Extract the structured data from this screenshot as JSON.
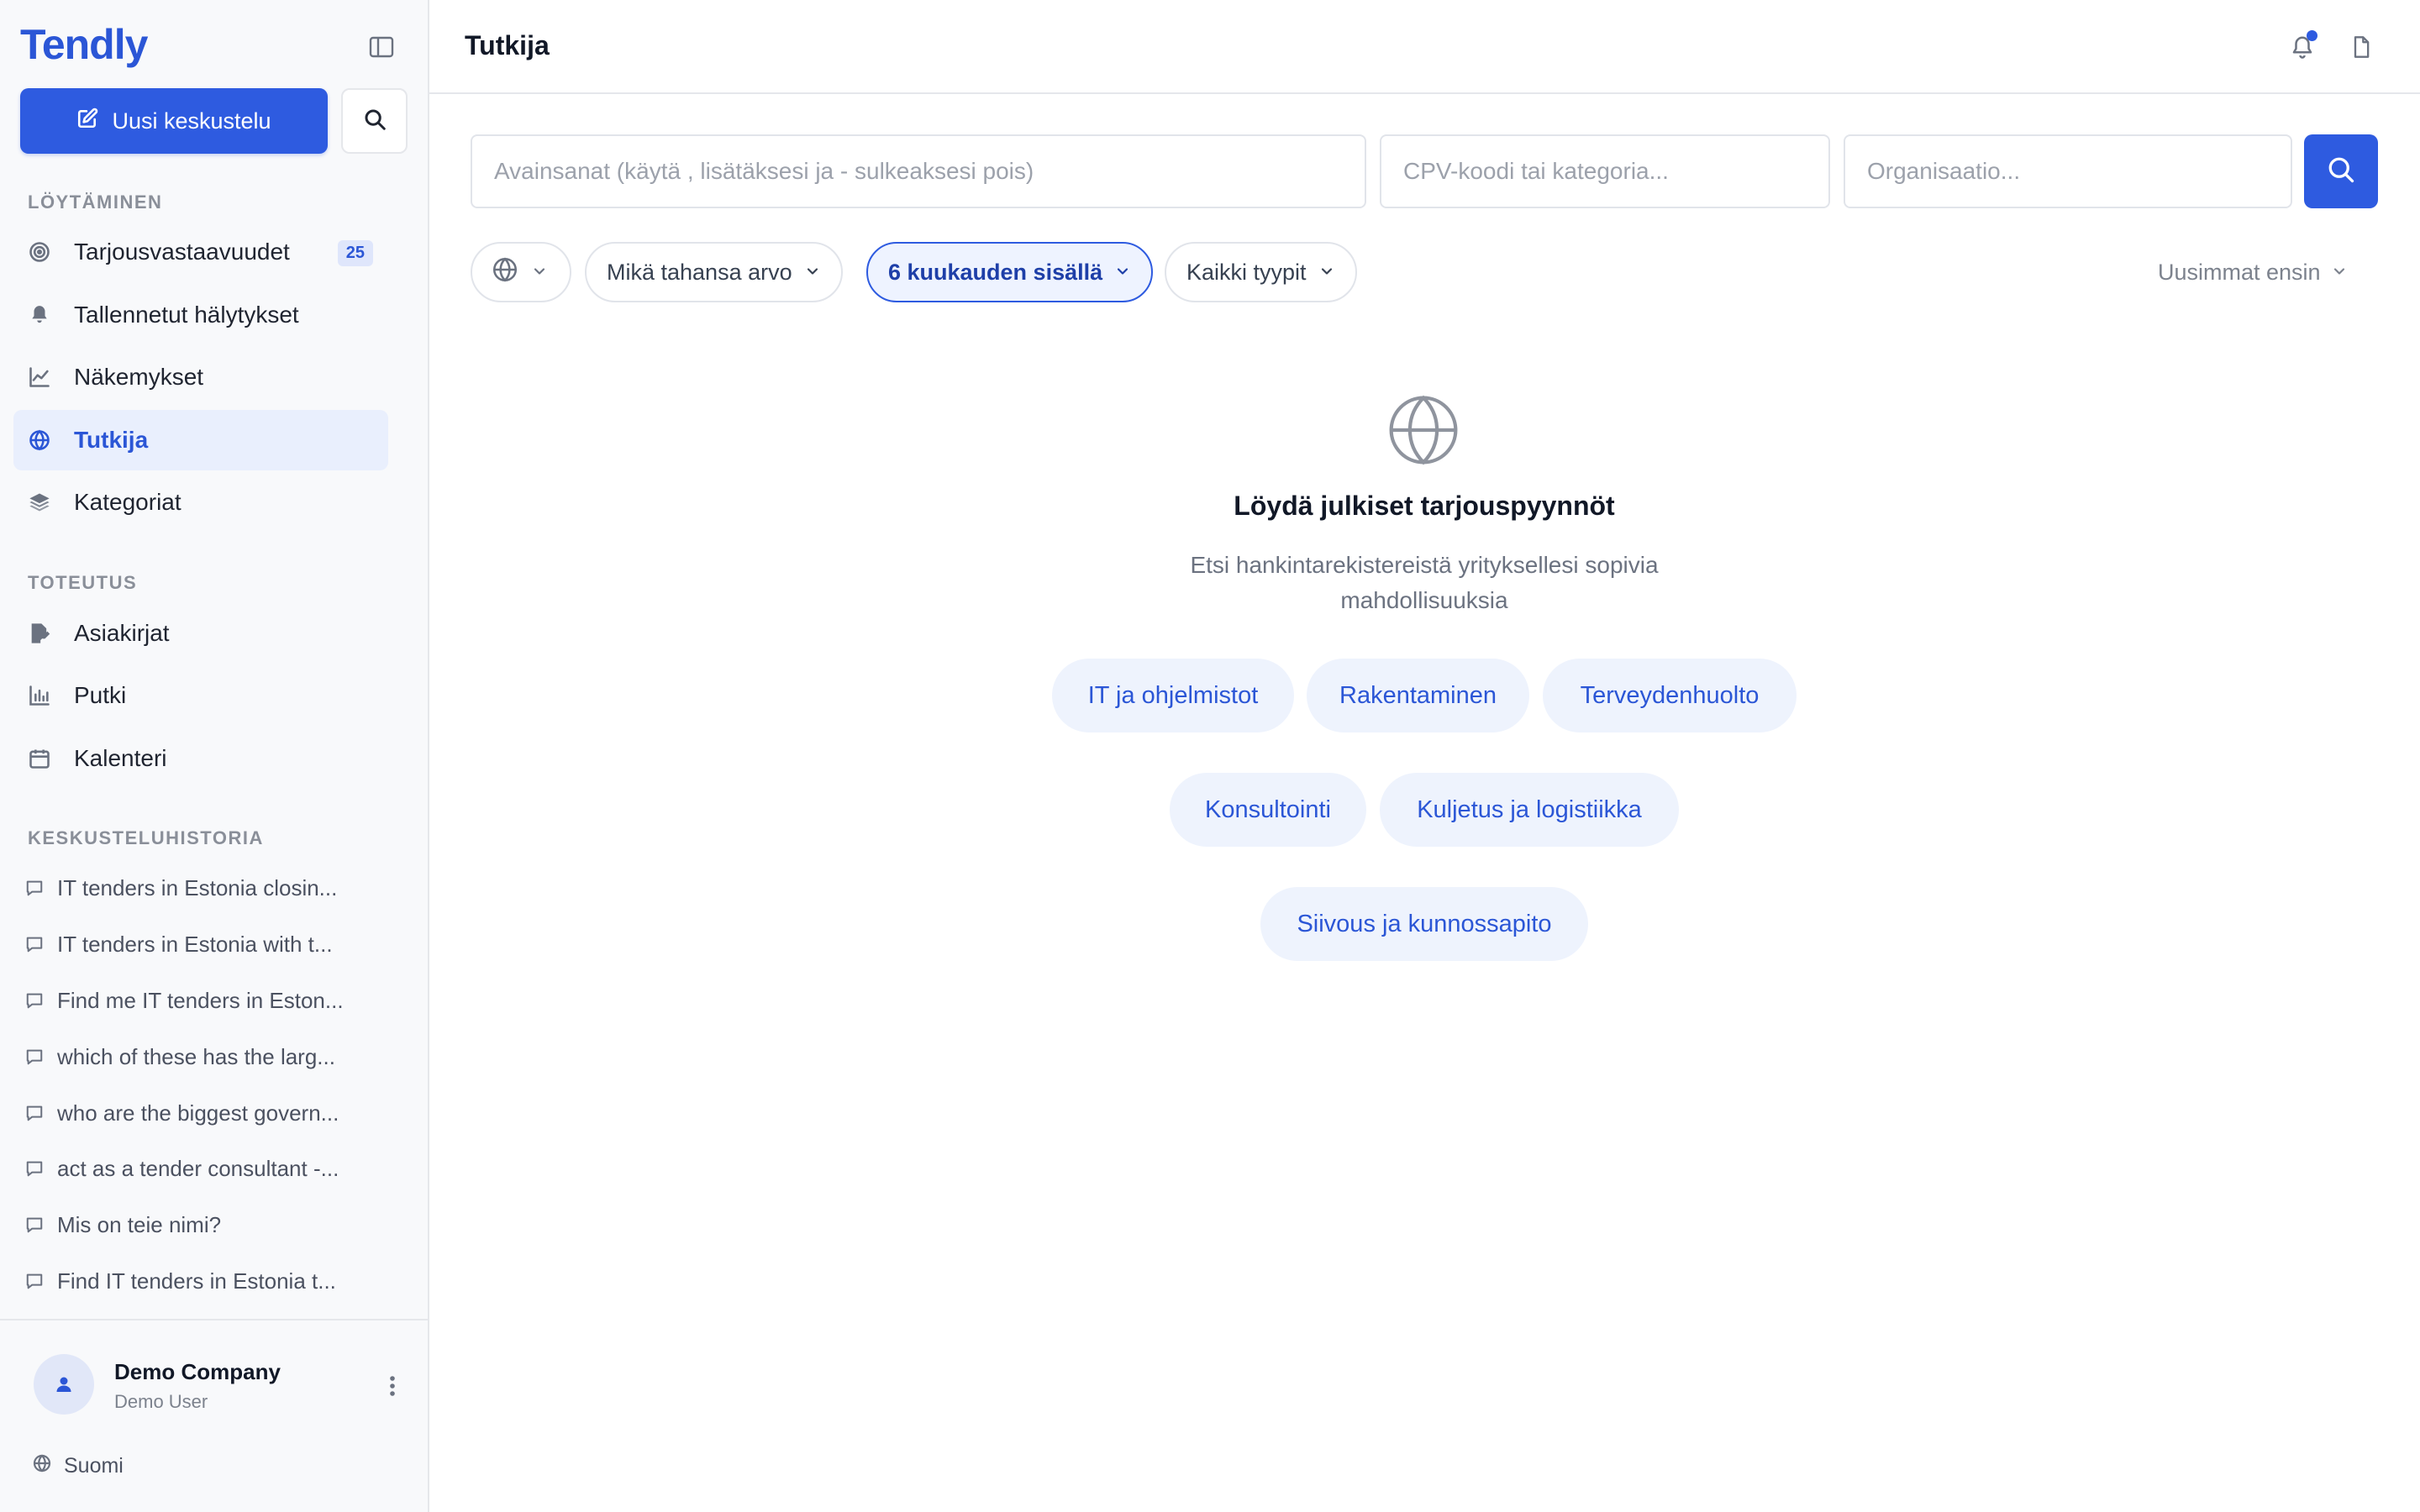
{
  "app": {
    "logo": "Tendly",
    "brand_color": "#2e5be0"
  },
  "sidebar": {
    "new_chat_label": "Uusi keskustelu",
    "sections": {
      "discovery": "LÖYTÄMINEN",
      "execution": "TOTEUTUS",
      "history": "KESKUSTELUHISTORIA"
    },
    "discovery_items": [
      {
        "label": "Tarjousvastaavuudet",
        "icon": "target-icon",
        "badge": "25"
      },
      {
        "label": "Tallennetut hälytykset",
        "icon": "bell-icon"
      },
      {
        "label": "Näkemykset",
        "icon": "chart-line-icon"
      },
      {
        "label": "Tutkija",
        "icon": "globe-icon",
        "active": true
      },
      {
        "label": "Kategoriat",
        "icon": "layers-icon"
      }
    ],
    "execution_items": [
      {
        "label": "Asiakirjat",
        "icon": "document-edit-icon"
      },
      {
        "label": "Putki",
        "icon": "bar-chart-icon"
      },
      {
        "label": "Kalenteri",
        "icon": "calendar-icon"
      }
    ],
    "history_items": [
      "IT tenders in Estonia closin...",
      "IT tenders in Estonia with t...",
      "Find me IT tenders in Eston...",
      "which of these has the larg...",
      "who are the biggest govern...",
      "act as a tender consultant -...",
      "Mis on teie nimi?",
      "Find IT tenders in Estonia t..."
    ],
    "footer": {
      "company": "Demo Company",
      "user": "Demo User",
      "language": "Suomi"
    }
  },
  "header": {
    "title": "Tutkija"
  },
  "search": {
    "keywords_placeholder": "Avainsanat (käytä , lisätäksesi ja - sulkeaksesi pois)",
    "cpv_placeholder": "CPV-koodi tai kategoria...",
    "org_placeholder": "Organisaatio...",
    "keywords_value": "",
    "cpv_value": "",
    "org_value": ""
  },
  "filters": {
    "value_filter": "Mikä tahansa arvo",
    "time_filter": "6 kuukauden sisällä",
    "type_filter": "Kaikki tyypit",
    "sort": "Uusimmat ensin"
  },
  "empty_state": {
    "title": "Löydä julkiset tarjouspyynnöt",
    "subtitle": "Etsi hankintarekistereistä yrityksellesi sopivia mahdollisuuksia",
    "categories": [
      "IT ja ohjelmistot",
      "Rakentaminen",
      "Terveydenhuolto",
      "Konsultointi",
      "Kuljetus ja logistiikka",
      "Siivous ja kunnossapito"
    ]
  }
}
